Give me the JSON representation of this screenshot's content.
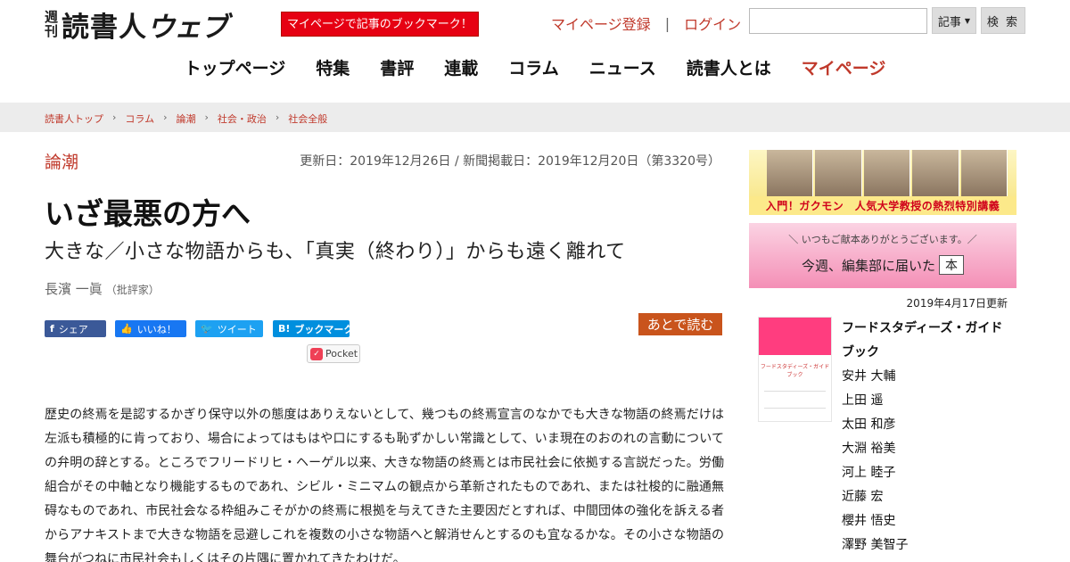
{
  "header": {
    "logo_weekly": [
      "週",
      "刊"
    ],
    "logo_main": "読書人",
    "logo_web": "ウェブ",
    "bookmark_promo": "マイページで記事のブックマーク！",
    "register_link": "マイページ登録",
    "link_separator": "|",
    "login_link": "ログイン",
    "search": {
      "placeholder": "",
      "scope": "記事",
      "button": "検 索"
    }
  },
  "nav": {
    "items": [
      "トップページ",
      "特集",
      "書評",
      "連載",
      "コラム",
      "ニュース",
      "読書人とは",
      "マイページ"
    ]
  },
  "breadcrumb": [
    "読書人トップ",
    "コラム",
    "論潮",
    "社会・政治",
    "社会全般"
  ],
  "article": {
    "category": "論潮",
    "dates": "更新日：2019年12月26日 / 新聞掲載日：2019年12月20日（第3320号）",
    "title": "いざ最悪の方へ",
    "subtitle": "大きな／小さな物語からも、「真実（終わり）」からも遠く離れて",
    "author": "長濱 一眞",
    "author_role": "（批評家）",
    "share": {
      "facebook": "シェア",
      "like": "いいね！",
      "tweet": "ツイート",
      "hatena": "ブックマーク",
      "hatena_icon": "B!",
      "pocket": "Pocket",
      "read_later": "あとで読む"
    },
    "body": "歴史の終焉を是認するかぎり保守以外の態度はありえないとして、幾つもの終焉宣言のなかでも大きな物語の終焉だけは左派も積極的に肯っており、場合によってはもはや口にするも恥ずかしい常識として、いま現在のおのれの言動についての弁明の辞とする。ところでフリードリヒ・ヘーゲル以来、大きな物語の終焉とは市民社会に依拠する言説だった。労働組合がその中軸となり機能するものであれ、シビル・ミニマムの観点から革新されたものであれ、または社梭的に融通無碍なものであれ、市民社会なる枠組みこそがかの終焉に根拠を与えてきた主要因だとすれば、中間団体の強化を訴える者からアナキストまで大きな物語を忌避しこれを複数の小さな物語へと解消せんとするのも宜なるかな。その小さな物語の舞台がつねに市民社会もしくはその片隅に置かれてきたわけだ。"
  },
  "sidebar": {
    "banner1_caption": "入門！ガクモン　人気大学教授の熱烈特別講義",
    "banner2_line1": "＼ いつもご献本ありがとうございます。／",
    "banner2_line2": "今週、編集部に届いた",
    "banner2_book": "本",
    "updated": "2019年4月17日更新",
    "book": {
      "cover_text": "フードスタディーズ・ガイドブック",
      "title": "フードスタディーズ・ガイドブック",
      "authors": [
        "安井 大輔",
        "上田 遥",
        "太田 和彦",
        "大淵 裕美",
        "河上 睦子",
        "近藤 宏",
        "櫻井 悟史",
        "澤野 美智子"
      ]
    }
  }
}
